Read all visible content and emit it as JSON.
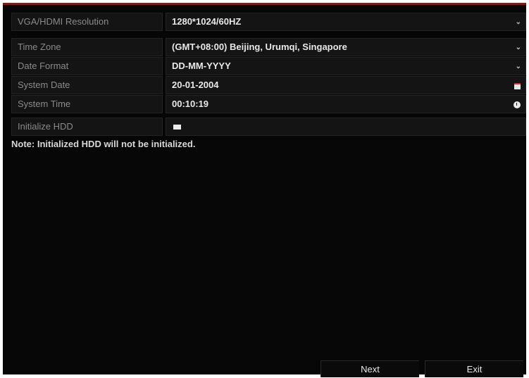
{
  "settings": [
    {
      "label": "VGA/HDMI Resolution",
      "value": "1280*1024/60HZ",
      "control": "dropdown"
    },
    {
      "label": "Time Zone",
      "value": "(GMT+08:00) Beijing, Urumqi, Singapore",
      "control": "dropdown"
    },
    {
      "label": "Date Format",
      "value": "DD-MM-YYYY",
      "control": "dropdown"
    },
    {
      "label": "System Date",
      "value": "20-01-2004",
      "control": "calendar"
    },
    {
      "label": "System Time",
      "value": "00:10:19",
      "control": "clock"
    }
  ],
  "initialize_hdd": {
    "label": "Initialize HDD",
    "checked": false
  },
  "note": "Note: Initialized HDD will not be initialized.",
  "buttons": {
    "next": "Next",
    "exit": "Exit"
  },
  "icons": {
    "dropdown": "chevron-down-icon",
    "calendar": "calendar-icon",
    "clock": "clock-icon"
  },
  "colors": {
    "background": "#060606",
    "field": "#141414",
    "accent": "#7a1d1d"
  }
}
